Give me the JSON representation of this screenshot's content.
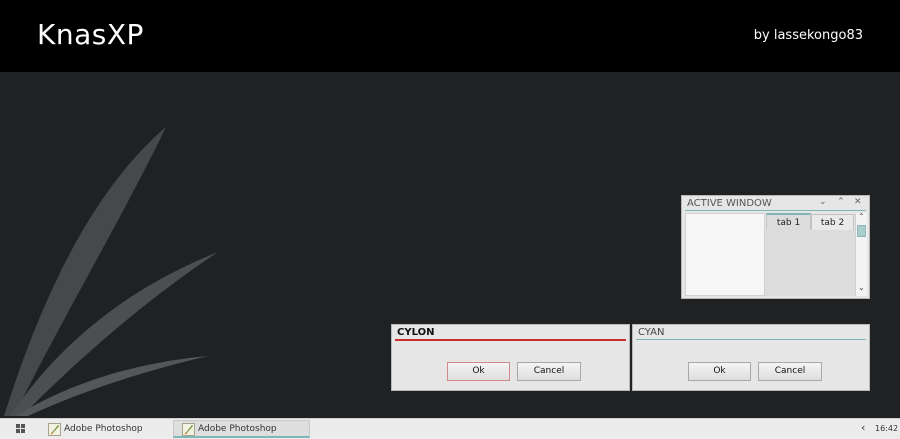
{
  "header": {
    "title": "KnasXP",
    "author": "by lassekongo83"
  },
  "active_window": {
    "title": "ACTIVE WINDOW",
    "controls": [
      "⌄",
      "⌃",
      "✕"
    ],
    "tabs": [
      {
        "label": "tab 1"
      },
      {
        "label": "tab 2"
      }
    ],
    "scroll_up": "⌃",
    "scroll_down": "⌄",
    "accent": "#7fb6b9"
  },
  "dialog_cylon": {
    "title": "CYLON",
    "ok_label": "Ok",
    "cancel_label": "Cancel",
    "accent": "#c9302c"
  },
  "dialog_cyan": {
    "title": "CYAN",
    "ok_label": "Ok",
    "cancel_label": "Cancel",
    "accent": "#7fb6b9"
  },
  "taskbar": {
    "start_icon": "windows-grid-icon",
    "tasks": [
      {
        "label": "Adobe Photoshop",
        "icon": "photoshop-feather-icon"
      },
      {
        "label": "Adobe Photoshop",
        "icon": "photoshop-feather-icon"
      }
    ],
    "tray_arrow": "‹",
    "clock": "16:42"
  },
  "colors": {
    "background": "#202123",
    "header": "#000000",
    "window": "#e6e6e6",
    "taskbar": "#ececec"
  }
}
